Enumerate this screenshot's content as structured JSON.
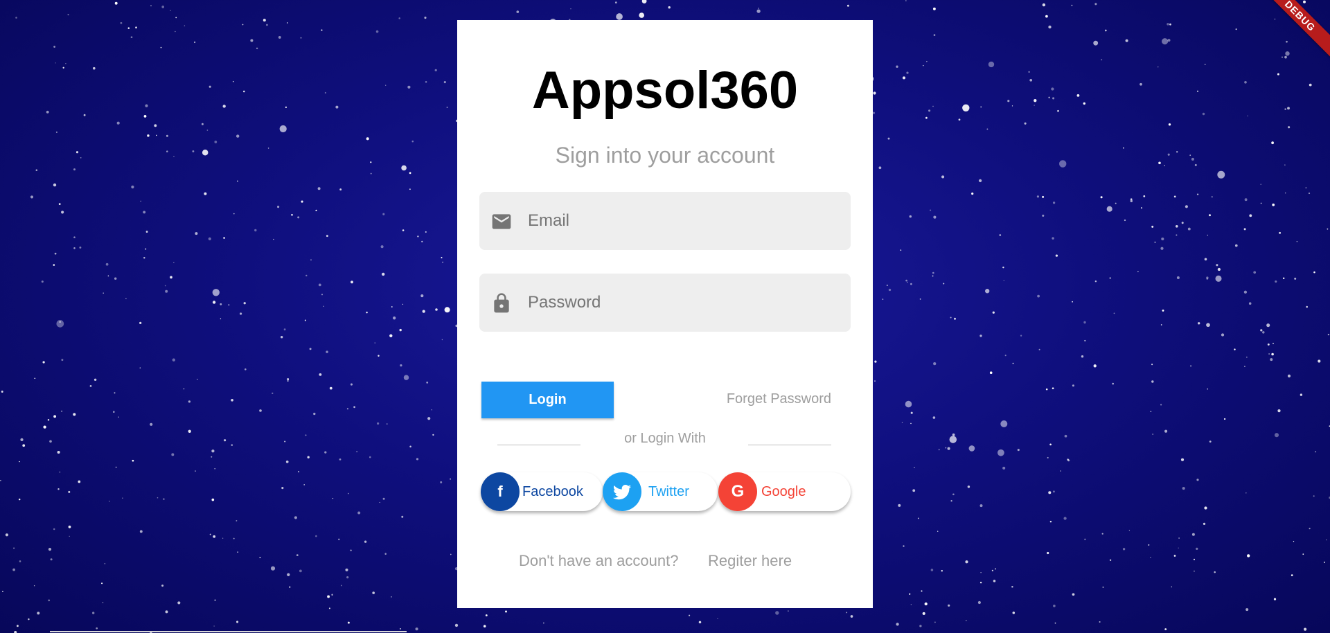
{
  "debug_banner": "DEBUG",
  "app": {
    "title": "Appsol360",
    "subtitle": "Sign into your account"
  },
  "email": {
    "placeholder": "Email",
    "icon": "mail-icon"
  },
  "password": {
    "placeholder": "Password",
    "icon": "lock-icon"
  },
  "actions": {
    "login_label": "Login",
    "forget_label": "Forget Password"
  },
  "divider_text": "or Login With",
  "social": {
    "facebook": {
      "label": "Facebook",
      "icon": "f",
      "color": "#0d47a1"
    },
    "twitter": {
      "label": "Twitter",
      "icon": "twitter-bird-icon",
      "color": "#1da1f2"
    },
    "google": {
      "label": "Google",
      "icon": "G",
      "color": "#f44336"
    }
  },
  "footer": {
    "prompt": "Don't have an account?",
    "register_label": "Regiter here"
  },
  "colors": {
    "primary": "#2196f3",
    "background": "#0f0f7e",
    "debug": "#b71c1c"
  }
}
